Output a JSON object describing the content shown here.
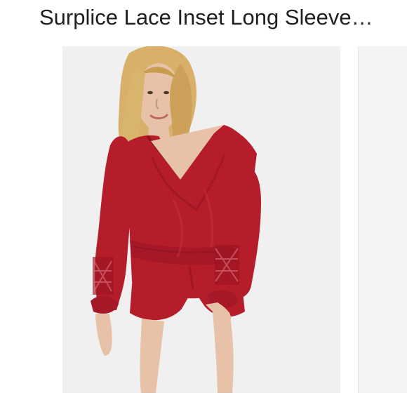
{
  "product": {
    "title": "Surplice Lace Inset Long Sleeve…"
  },
  "gallery": {
    "main_image": {
      "alt": "Surplice Lace Inset Long Sleeve Romper",
      "garment_color": "#b51d2b"
    },
    "next_image_peek": {
      "alt": "Next product image"
    }
  },
  "colors": {
    "background": "#ffffff",
    "image_background": "#f3f3f3",
    "title_text": "#1f1f1f",
    "garment": "#b51d2b",
    "garment_shadow": "#8f1320",
    "skin": "#e8c2a8",
    "hair": "#d8b06a"
  }
}
